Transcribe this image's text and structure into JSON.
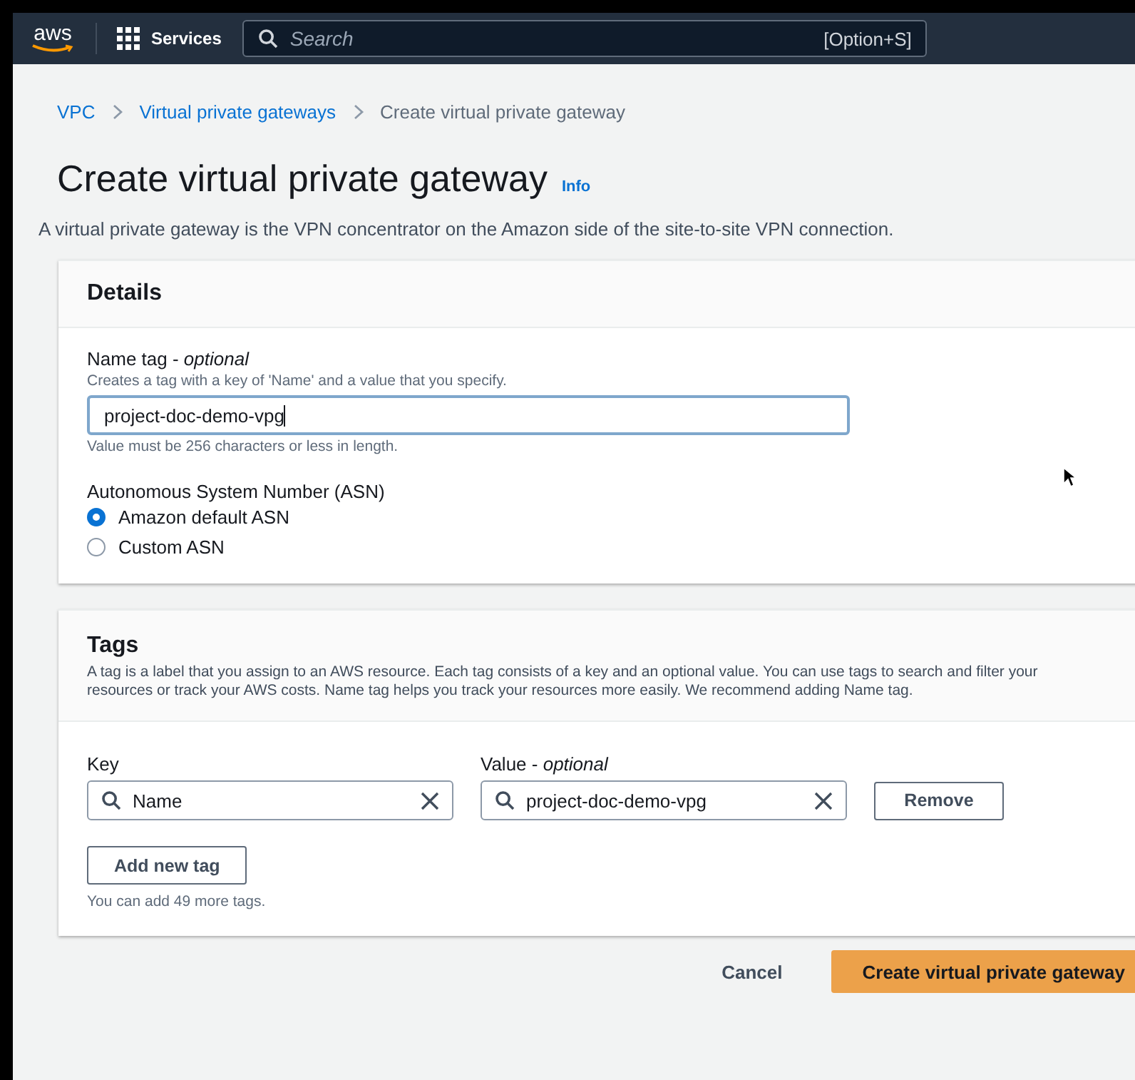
{
  "top_nav": {
    "logo": "aws",
    "services": "Services",
    "search": {
      "placeholder": "Search",
      "shortcut": "[Option+S]"
    }
  },
  "breadcrumbs": [
    {
      "label": "VPC",
      "link": true
    },
    {
      "label": "Virtual private gateways",
      "link": true
    },
    {
      "label": "Create virtual private gateway",
      "link": false
    }
  ],
  "page": {
    "title": "Create virtual private gateway",
    "info": "Info",
    "description": "A virtual private gateway is the VPN concentrator on the Amazon side of the site-to-site VPN connection."
  },
  "details": {
    "heading": "Details",
    "name_tag": {
      "label": "Name tag - *optional*",
      "hint": "Creates a tag with a key of 'Name' and a value that you specify.",
      "value": "project-doc-demo-vpg",
      "constraint": "Value must be 256 characters or less in length."
    },
    "asn": {
      "label": "Autonomous System Number (ASN)",
      "options": [
        {
          "label": "Amazon default ASN",
          "selected": true
        },
        {
          "label": "Custom ASN",
          "selected": false
        }
      ]
    }
  },
  "tags": {
    "heading": "Tags",
    "description": "A tag is a label that you assign to an AWS resource. Each tag consists of a key and an optional value. You can use tags to search and filter your resources or track your AWS costs. Name tag helps you track your resources more easily. We recommend adding Name tag.",
    "key_label": "Key",
    "value_label": "Value - *optional*",
    "rows": [
      {
        "key": "Name",
        "value": "project-doc-demo-vpg",
        "remove": "Remove"
      }
    ],
    "add_button": "Add new tag",
    "limit_note": "You can add 49 more tags."
  },
  "actions": {
    "cancel": "Cancel",
    "submit": "Create virtual private gateway"
  }
}
